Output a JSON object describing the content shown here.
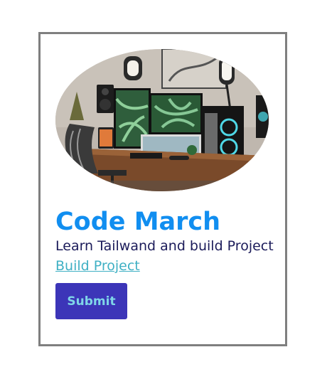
{
  "card": {
    "title": "Code March",
    "subtitle": "Learn Tailwand and build Project",
    "link_label": "Build Project",
    "submit_label": "Submit"
  },
  "colors": {
    "title": "#118ef0",
    "subtitle": "#1b1b5a",
    "link": "#3fb0c4",
    "button_bg": "#3c35b8",
    "button_text": "#7fd6e8",
    "card_border": "#7f7f7f"
  }
}
